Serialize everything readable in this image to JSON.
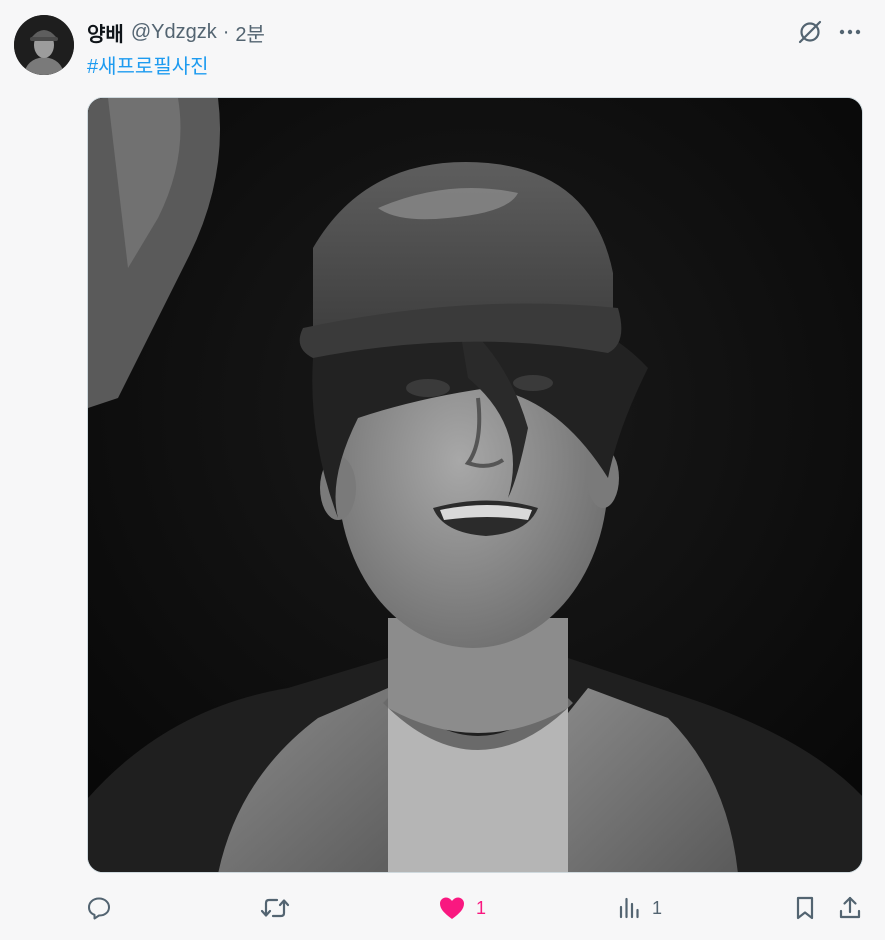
{
  "post": {
    "author_name": "양배",
    "author_handle": "@Ydzgzk",
    "separator": "·",
    "time_ago": "2분",
    "hashtag": "#새프로필사진"
  },
  "media": {
    "tone": "black-and-white"
  },
  "actions": {
    "reply_icon": "reply-icon",
    "repost_icon": "repost-icon",
    "like_icon": "heart-filled-icon",
    "like_count": "1",
    "views_icon": "views-icon",
    "views_count": "1",
    "bookmark_icon": "bookmark-icon",
    "share_icon": "share-icon"
  },
  "colors": {
    "link": "#1d9bf0",
    "secondary_text": "#536471",
    "like_active": "#f91880",
    "background": "#f7f7f8"
  }
}
